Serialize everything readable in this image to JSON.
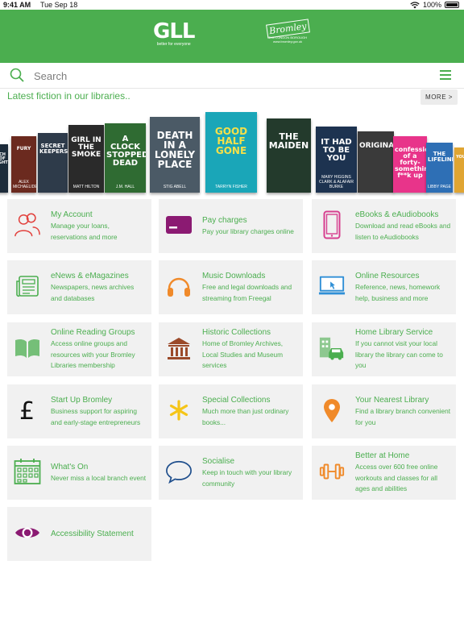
{
  "status": {
    "time": "9:41 AM",
    "date": "Tue Sep 18",
    "battery": "100%"
  },
  "header": {
    "brand": "GLL",
    "tagline": "better for everyone",
    "partner_logo": "Bromley",
    "partner_line1": "THE LONDON BOROUGH",
    "partner_line2": "www.bromley.gov.uk",
    "bg_color": "#4bae4f"
  },
  "search": {
    "placeholder": "Search"
  },
  "latest": {
    "title": "Latest fiction in our libraries..",
    "more_label": "MORE >",
    "books": [
      {
        "title": "CH OF GHT",
        "author": "",
        "color": "#1c2b3a"
      },
      {
        "title": "FURY",
        "author": "ALEX MICHAELIDES",
        "color": "#6b2a1f"
      },
      {
        "title": "SECRET KEEPERS",
        "author": "",
        "color": "#2e3b4a"
      },
      {
        "title": "GIRL IN THE SMOKE",
        "author": "MATT HILTON",
        "color": "#2a2a2a"
      },
      {
        "title": "A CLOCK STOPPED DEAD",
        "author": "J.M. HALL",
        "color": "#2f6b32"
      },
      {
        "title": "DEATH IN A LONELY PLACE",
        "author": "STIG ABELL",
        "color": "#4b5a66"
      },
      {
        "title": "GOOD HALF GONE",
        "author": "TARRYN FISHER",
        "color": "#1aa6b8"
      },
      {
        "title": "THE MAIDEN",
        "author": "",
        "color": "#233a2c"
      },
      {
        "title": "IT HAD TO BE YOU",
        "author": "MARY HIGGINS CLARK & ALAFAIR BURKE",
        "color": "#1d3350"
      },
      {
        "title": "ORIGINAL",
        "author": "",
        "color": "#3a3a3a"
      },
      {
        "title": "confessions of a forty-something f**k up",
        "author": "",
        "color": "#e8348a"
      },
      {
        "title": "THE LIFELINE",
        "author": "LIBBY PAGE",
        "color": "#2e6fb5"
      },
      {
        "title": "YOU",
        "author": "",
        "color": "#e0a532"
      }
    ]
  },
  "cards": [
    {
      "title": "My Account",
      "desc": "Manage your loans, reservations and more",
      "icon": "users-icon"
    },
    {
      "title": "Pay charges",
      "desc": "Pay your library charges online",
      "icon": "credit-card-icon"
    },
    {
      "title": "eBooks & eAudiobooks",
      "desc": "Download and read eBooks and listen to eAudiobooks",
      "icon": "tablet-icon"
    },
    {
      "title": "eNews & eMagazines",
      "desc": "Newspapers, news archives and databases",
      "icon": "newspaper-icon"
    },
    {
      "title": "Music Downloads",
      "desc": "Free and legal downloads and streaming from Freegal",
      "icon": "headphones-icon"
    },
    {
      "title": "Online Resources",
      "desc": "Reference, news, homework help, business and more",
      "icon": "monitor-icon"
    },
    {
      "title": "Online Reading Groups",
      "desc": "Access online groups and resources with your Bromley Libraries membership",
      "icon": "open-book-icon"
    },
    {
      "title": "Historic Collections",
      "desc": "Home of Bromley Archives, Local Studies and Museum services",
      "icon": "museum-icon"
    },
    {
      "title": "Home Library Service",
      "desc": "If you cannot visit your local library the library can come to you",
      "icon": "car-building-icon"
    },
    {
      "title": "Start Up Bromley",
      "desc": "Business support for aspiring and early-stage entrepreneurs",
      "icon": "pound-icon"
    },
    {
      "title": "Special Collections",
      "desc": "Much more than just ordinary books...",
      "icon": "asterisk-icon"
    },
    {
      "title": "Your Nearest Library",
      "desc": "Find a library branch convenient for you",
      "icon": "map-pin-icon"
    },
    {
      "title": "What's On",
      "desc": "Never miss a local branch event",
      "icon": "calendar-icon"
    },
    {
      "title": "Socialise",
      "desc": "Keep in touch with your library community",
      "icon": "speech-bubble-icon"
    },
    {
      "title": "Better at Home",
      "desc": "Access over 600 free online workouts and classes for all ages and abilities",
      "icon": "dumbbell-icon"
    },
    {
      "title": "Accessibility Statement",
      "desc": "",
      "icon": "eye-icon"
    }
  ]
}
